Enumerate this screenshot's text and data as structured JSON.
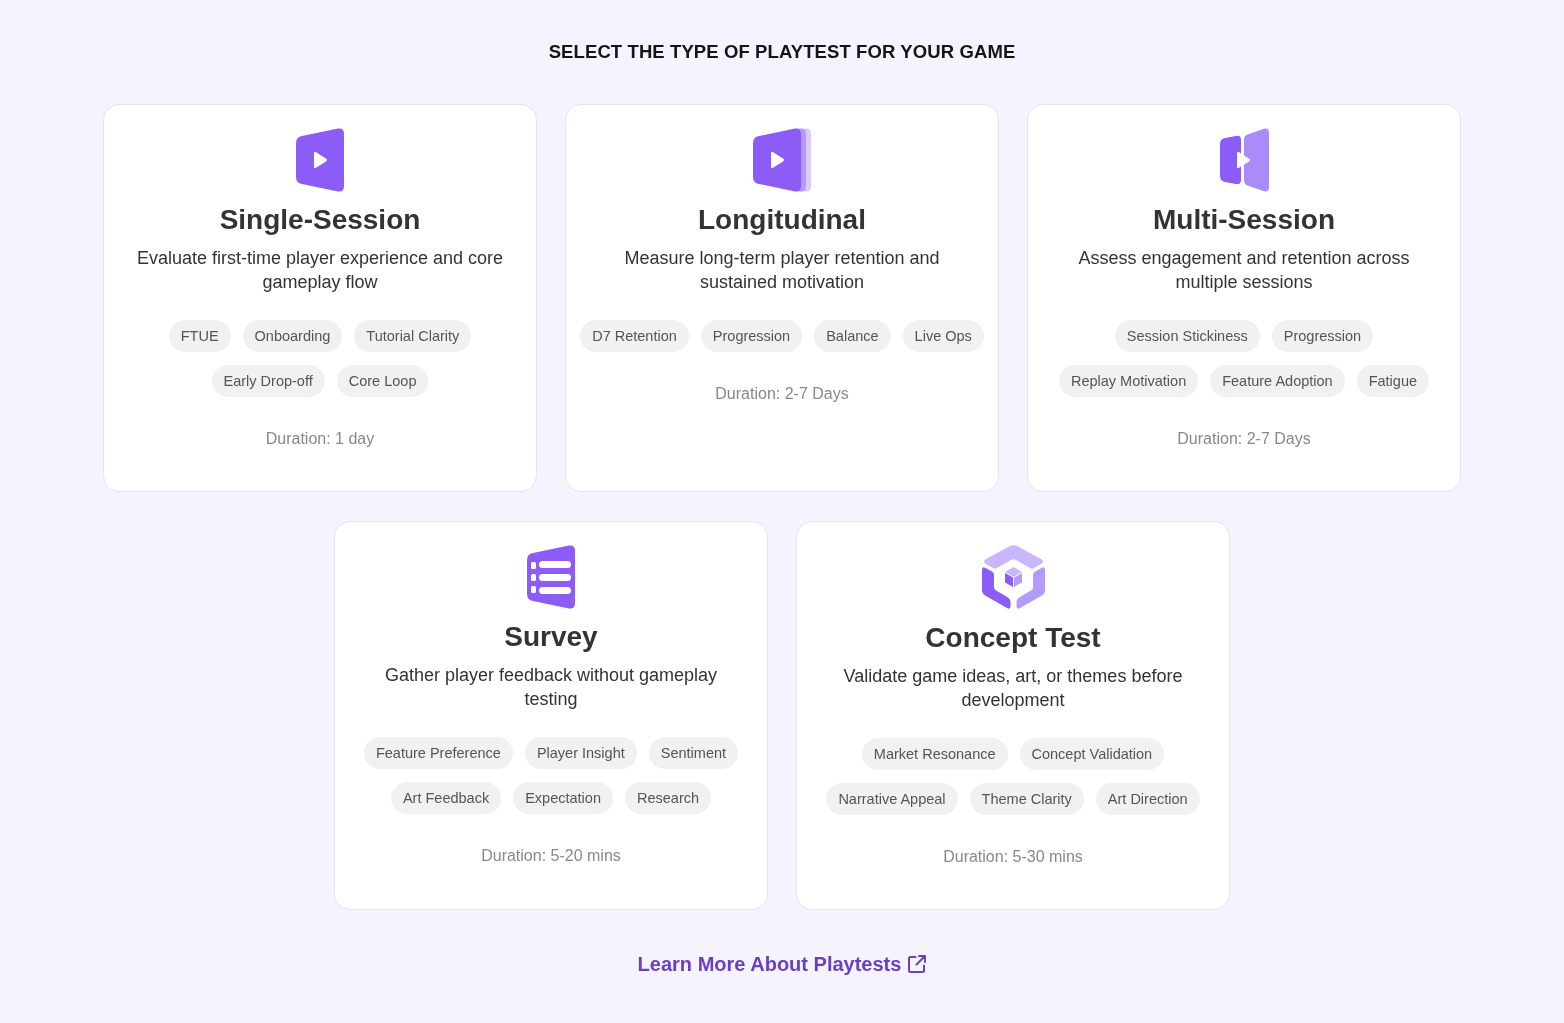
{
  "title": "SELECT THE TYPE OF PLAYTEST FOR YOUR GAME",
  "cards": [
    {
      "kind": "single",
      "title": "Single-Session",
      "description": "Evaluate first-time player experience and core gameplay flow",
      "tags": [
        "FTUE",
        "Onboarding",
        "Tutorial Clarity",
        "Early Drop-off",
        "Core Loop"
      ],
      "duration": "Duration: 1 day"
    },
    {
      "kind": "stacked",
      "title": "Longitudinal",
      "description": "Measure long-term player retention and sustained motivation",
      "tags": [
        "D7 Retention",
        "Progression",
        "Balance",
        "Live Ops"
      ],
      "duration": "Duration: 2-7 Days"
    },
    {
      "kind": "split",
      "title": "Multi-Session",
      "description": "Assess engagement and retention across multiple sessions",
      "tags": [
        "Session Stickiness",
        "Progression",
        "Replay Motivation",
        "Feature Adoption",
        "Fatigue"
      ],
      "duration": "Duration: 2-7 Days"
    },
    {
      "kind": "list",
      "title": "Survey",
      "description": "Gather player feedback without gameplay testing",
      "tags": [
        "Feature Preference",
        "Player Insight",
        "Sentiment",
        "Art Feedback",
        "Expectation",
        "Research"
      ],
      "duration": "Duration: 5-20 mins"
    },
    {
      "kind": "cube",
      "title": "Concept Test",
      "description": "Validate game ideas, art, or themes before development",
      "tags": [
        "Market Resonance",
        "Concept Validation",
        "Narrative Appeal",
        "Theme Clarity",
        "Art Direction"
      ],
      "duration": "Duration: 5-30 mins"
    }
  ],
  "link": {
    "label": "Learn More About Playtests"
  }
}
